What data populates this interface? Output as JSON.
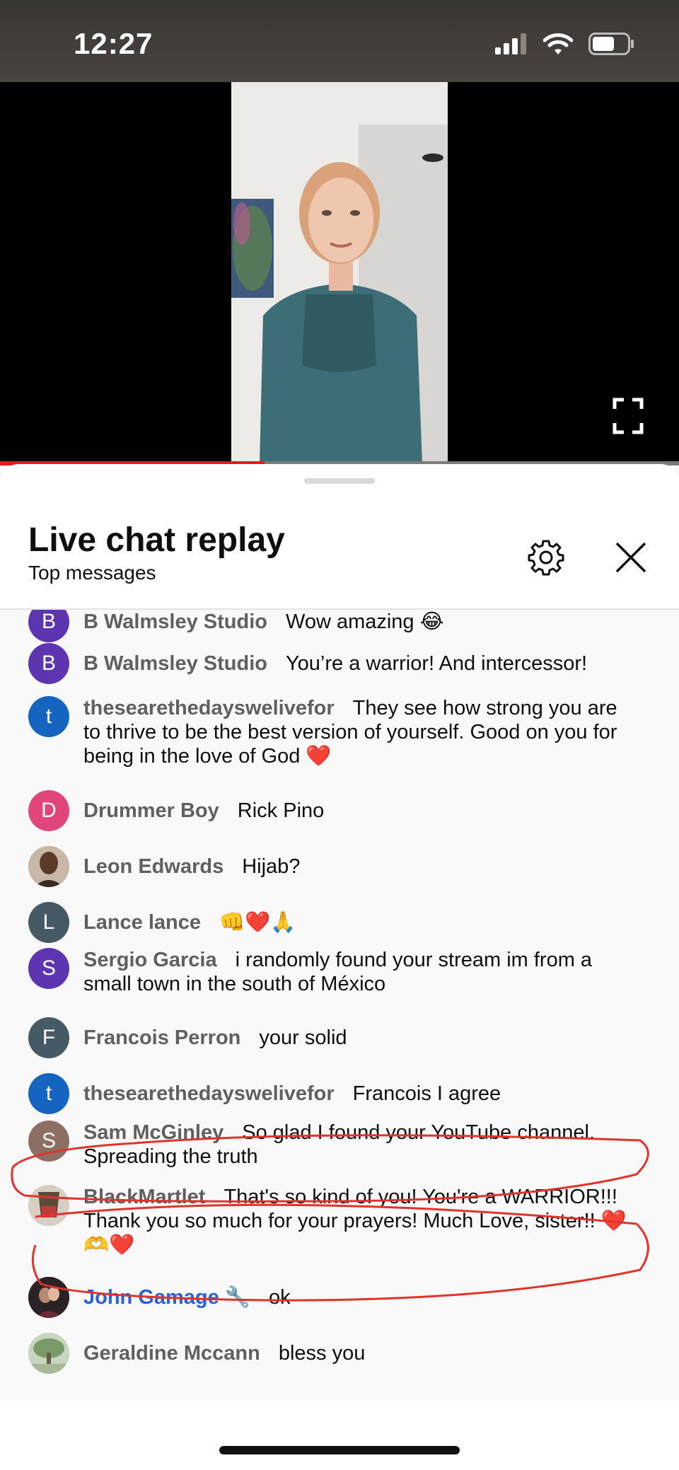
{
  "status_bar": {
    "time": "12:27"
  },
  "video": {
    "progress": 0.39
  },
  "panel": {
    "title": "Live chat replay",
    "subtitle": "Top messages"
  },
  "messages": [
    {
      "initial": "B",
      "avatar_color": "#5e35b1",
      "author": "B Walmsley Studio",
      "text": "Wow amazing 😂"
    },
    {
      "initial": "B",
      "avatar_color": "#5e35b1",
      "author": "B Walmsley Studio",
      "text": "You’re a warrior! And intercessor!"
    },
    {
      "initial": "t",
      "avatar_color": "#1565c0",
      "author": "thesearethedayswelivefor",
      "text": "They see how strong you are to thrive to be the best version of yourself. Good on you for being in the love of God ❤️"
    },
    {
      "initial": "D",
      "avatar_color": "#e0457b",
      "author": "Drummer Boy",
      "text": "Rick Pino"
    },
    {
      "initial": "",
      "avatar_color": "#7a5a45",
      "author": "Leon Edwards",
      "text": "Hijab?"
    },
    {
      "initial": "L",
      "avatar_color": "#455a64",
      "author": "Lance lance",
      "text": "👊❤️🙏"
    },
    {
      "initial": "S",
      "avatar_color": "#5e35b1",
      "author": "Sergio Garcia",
      "text": "i randomly found your stream im from a small town in the south of México"
    },
    {
      "initial": "F",
      "avatar_color": "#455a64",
      "author": "Francois Perron",
      "text": "your solid"
    },
    {
      "initial": "t",
      "avatar_color": "#1565c0",
      "author": "thesearethedayswelivefor",
      "text": "Francois I agree"
    },
    {
      "initial": "S",
      "avatar_color": "#8d6e63",
      "author": "Sam McGinley",
      "text": "So glad I found your YouTube channel. Spreading the truth"
    },
    {
      "initial": "",
      "avatar_color": "#b0a090",
      "author": "BlackMartlet",
      "text": "That's so kind of you! You're a WARRIOR!!! Thank you so much for your prayers! Much Love, sister!! ❤️🫶❤️"
    },
    {
      "initial": "",
      "avatar_color": "#3a2c2a",
      "author": "John Gamage 🔧",
      "text": "ok",
      "owner": true
    },
    {
      "initial": "",
      "avatar_color": "#8fa88a",
      "author": "Geraldine Mccann",
      "text": "bless you"
    }
  ]
}
